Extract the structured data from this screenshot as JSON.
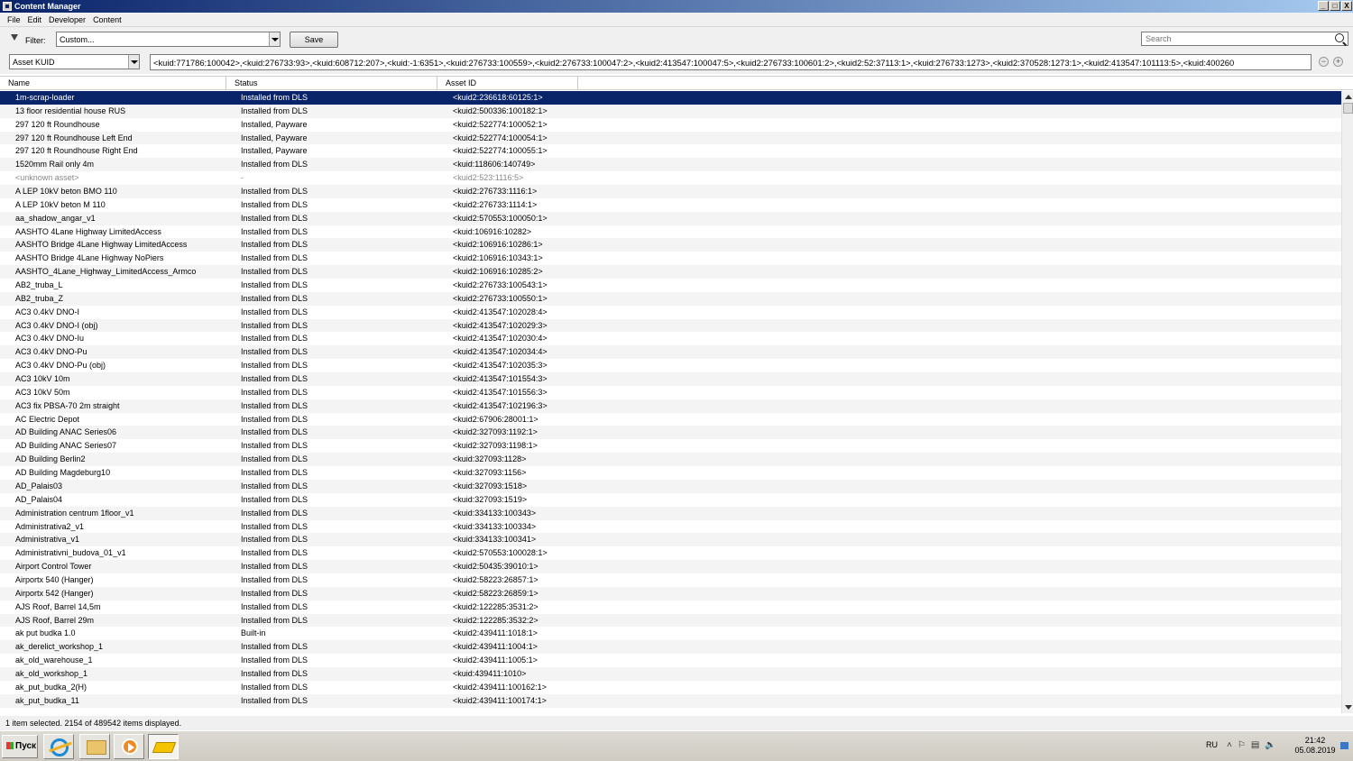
{
  "window": {
    "title": "Content Manager",
    "btn_min": "_",
    "btn_max": "□",
    "btn_close": "X"
  },
  "menu": [
    "File",
    "Edit",
    "Developer",
    "Content"
  ],
  "toolbar": {
    "filter_label": "Filter:",
    "filter_value": "Custom...",
    "save_label": "Save",
    "search_placeholder": "Search",
    "kuid_type": "Asset KUID",
    "kuid_list": "<kuid:771786:100042>,<kuid:276733:93>,<kuid:608712:207>,<kuid:-1:6351>,<kuid:276733:100559>,<kuid2:276733:100047:2>,<kuid2:413547:100047:5>,<kuid2:276733:100601:2>,<kuid2:52:37113:1>,<kuid:276733:1273>,<kuid2:370528:1273:1>,<kuid2:413547:101113:5>,<kuid:400260",
    "remove_btn": "−",
    "add_btn": "+"
  },
  "columns": {
    "name": "Name",
    "status": "Status",
    "asset_id": "Asset ID"
  },
  "rows": [
    {
      "name": "1m-scrap-loader",
      "status": "Installed from DLS",
      "id": "<kuid2:236618:60125:1>",
      "selected": true
    },
    {
      "name": "13 floor residential house RUS",
      "status": "Installed from DLS",
      "id": "<kuid2:500336:100182:1>"
    },
    {
      "name": "297 120 ft Roundhouse",
      "status": "Installed, Payware",
      "id": "<kuid2:522774:100052:1>"
    },
    {
      "name": "297 120 ft Roundhouse Left End",
      "status": "Installed, Payware",
      "id": "<kuid2:522774:100054:1>"
    },
    {
      "name": "297 120 ft Roundhouse Right End",
      "status": "Installed, Payware",
      "id": "<kuid2:522774:100055:1>"
    },
    {
      "name": "1520mm Rail only 4m",
      "status": "Installed from DLS",
      "id": "<kuid:118606:140749>"
    },
    {
      "name": "<unknown asset>",
      "status": "-",
      "id": "<kuid2:523:1116:5>",
      "grey": true
    },
    {
      "name": "A LEP 10kV beton BMO 110",
      "status": "Installed from DLS",
      "id": "<kuid2:276733:1116:1>"
    },
    {
      "name": "A LEP 10kV beton M 110",
      "status": "Installed from DLS",
      "id": "<kuid2:276733:1114:1>"
    },
    {
      "name": "aa_shadow_angar_v1",
      "status": "Installed from DLS",
      "id": "<kuid2:570553:100050:1>"
    },
    {
      "name": "AASHTO 4Lane Highway LimitedAccess",
      "status": "Installed from DLS",
      "id": "<kuid:106916:10282>"
    },
    {
      "name": "AASHTO Bridge 4Lane Highway LimitedAccess",
      "status": "Installed from DLS",
      "id": "<kuid2:106916:10286:1>"
    },
    {
      "name": "AASHTO Bridge 4Lane Highway NoPiers",
      "status": "Installed from DLS",
      "id": "<kuid2:106916:10343:1>"
    },
    {
      "name": "AASHTO_4Lane_Highway_LimitedAccess_Armco",
      "status": "Installed from DLS",
      "id": "<kuid2:106916:10285:2>"
    },
    {
      "name": "AB2_truba_L",
      "status": "Installed from DLS",
      "id": "<kuid2:276733:100543:1>"
    },
    {
      "name": "AB2_truba_Z",
      "status": "Installed from DLS",
      "id": "<kuid2:276733:100550:1>"
    },
    {
      "name": "AC3 0.4kV DNO-I",
      "status": "Installed from DLS",
      "id": "<kuid2:413547:102028:4>"
    },
    {
      "name": "AC3 0.4kV DNO-I (obj)",
      "status": "Installed from DLS",
      "id": "<kuid2:413547:102029:3>"
    },
    {
      "name": "AC3 0.4kV DNO-Iu",
      "status": "Installed from DLS",
      "id": "<kuid2:413547:102030:4>"
    },
    {
      "name": "AC3 0.4kV DNO-Pu",
      "status": "Installed from DLS",
      "id": "<kuid2:413547:102034:4>"
    },
    {
      "name": "AC3 0.4kV DNO-Pu (obj)",
      "status": "Installed from DLS",
      "id": "<kuid2:413547:102035:3>"
    },
    {
      "name": "AC3 10kV 10m",
      "status": "Installed from DLS",
      "id": "<kuid2:413547:101554:3>"
    },
    {
      "name": "AC3 10kV 50m",
      "status": "Installed from DLS",
      "id": "<kuid2:413547:101556:3>"
    },
    {
      "name": "AC3 fix PBSA-70 2m straight",
      "status": "Installed from DLS",
      "id": "<kuid2:413547:102196:3>"
    },
    {
      "name": "AC Electric Depot",
      "status": "Installed from DLS",
      "id": "<kuid2:67906:28001:1>"
    },
    {
      "name": "AD Building ANAC Series06",
      "status": "Installed from DLS",
      "id": "<kuid2:327093:1192:1>"
    },
    {
      "name": "AD Building ANAC Series07",
      "status": "Installed from DLS",
      "id": "<kuid2:327093:1198:1>"
    },
    {
      "name": "AD Building Berlin2",
      "status": "Installed from DLS",
      "id": "<kuid:327093:1128>"
    },
    {
      "name": "AD Building Magdeburg10",
      "status": "Installed from DLS",
      "id": "<kuid:327093:1156>"
    },
    {
      "name": "AD_Palais03",
      "status": "Installed from DLS",
      "id": "<kuid:327093:1518>"
    },
    {
      "name": "AD_Palais04",
      "status": "Installed from DLS",
      "id": "<kuid:327093:1519>"
    },
    {
      "name": "Administration centrum 1floor_v1",
      "status": "Installed from DLS",
      "id": "<kuid:334133:100343>"
    },
    {
      "name": "Administrativa2_v1",
      "status": "Installed from DLS",
      "id": "<kuid:334133:100334>"
    },
    {
      "name": "Administrativa_v1",
      "status": "Installed from DLS",
      "id": "<kuid:334133:100341>"
    },
    {
      "name": "Administrativni_budova_01_v1",
      "status": "Installed from DLS",
      "id": "<kuid2:570553:100028:1>"
    },
    {
      "name": "Airport Control Tower",
      "status": "Installed from DLS",
      "id": "<kuid2:50435:39010:1>"
    },
    {
      "name": "Airportx 540 (Hanger)",
      "status": "Installed from DLS",
      "id": "<kuid2:58223:26857:1>"
    },
    {
      "name": "Airportx 542 (Hanger)",
      "status": "Installed from DLS",
      "id": "<kuid2:58223:26859:1>"
    },
    {
      "name": "AJS Roof, Barrel 14,5m",
      "status": "Installed from DLS",
      "id": "<kuid2:122285:3531:2>"
    },
    {
      "name": "AJS Roof, Barrel 29m",
      "status": "Installed from DLS",
      "id": "<kuid2:122285:3532:2>"
    },
    {
      "name": "ak put budka 1.0",
      "status": "Built-in",
      "id": "<kuid2:439411:1018:1>"
    },
    {
      "name": "ak_derelict_workshop_1",
      "status": "Installed from DLS",
      "id": "<kuid2:439411:1004:1>"
    },
    {
      "name": "ak_old_warehouse_1",
      "status": "Installed from DLS",
      "id": "<kuid2:439411:1005:1>"
    },
    {
      "name": "ak_old_workshop_1",
      "status": "Installed from DLS",
      "id": "<kuid:439411:1010>"
    },
    {
      "name": "ak_put_budka_2(H)",
      "status": "Installed from DLS",
      "id": "<kuid2:439411:100162:1>"
    },
    {
      "name": "ak_put_budka_11",
      "status": "Installed from DLS",
      "id": "<kuid2:439411:100174:1>"
    }
  ],
  "status_bar": "1 item selected. 2154 of 489542 items displayed.",
  "taskbar": {
    "start_label": "Пуск",
    "language": "RU",
    "time": "21:42",
    "date": "05.08.2019"
  }
}
